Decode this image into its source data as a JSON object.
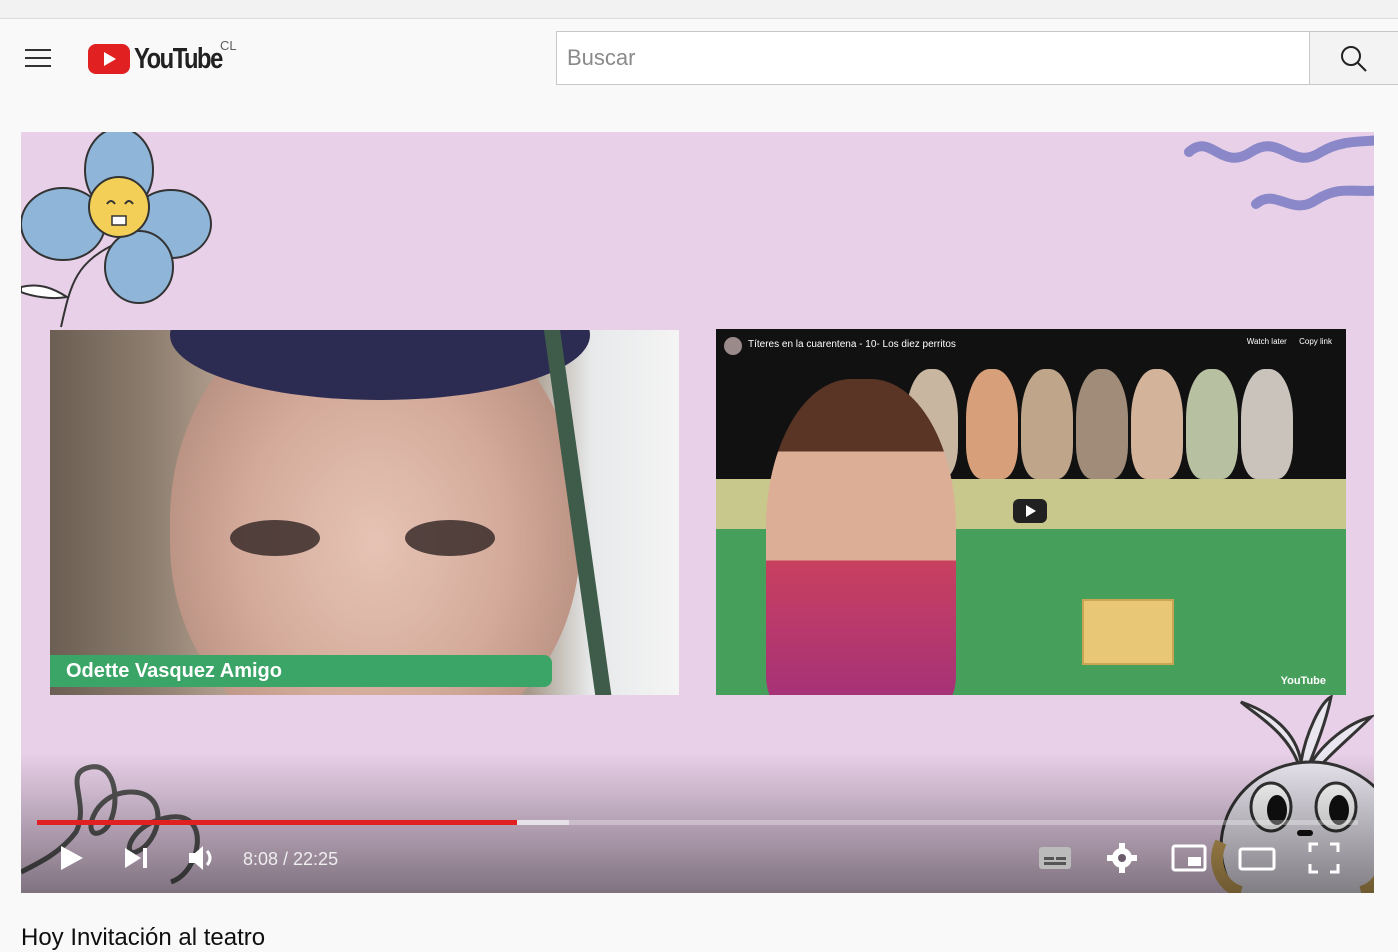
{
  "header": {
    "logo_text": "YouTube",
    "country_code": "CL",
    "search_placeholder": "Buscar"
  },
  "player": {
    "name_tag": "Odette Vasquez Amigo",
    "embedded_video_title": "Títeres en la cuarentena - 10- Los diez perritos",
    "embedded_watch_later": "Watch later",
    "embedded_copy_link": "Copy link",
    "embedded_brand": "YouTube",
    "current_time": "8:08",
    "duration": "22:25",
    "time_display": "8:08 / 22:25",
    "played_fraction": 0.363,
    "buffered_fraction": 0.403
  },
  "video": {
    "title": "Hoy Invitación al teatro"
  },
  "colors": {
    "brand_red": "#e02021",
    "player_background": "#e8d0e8",
    "name_tag_green": "#3aa566"
  }
}
